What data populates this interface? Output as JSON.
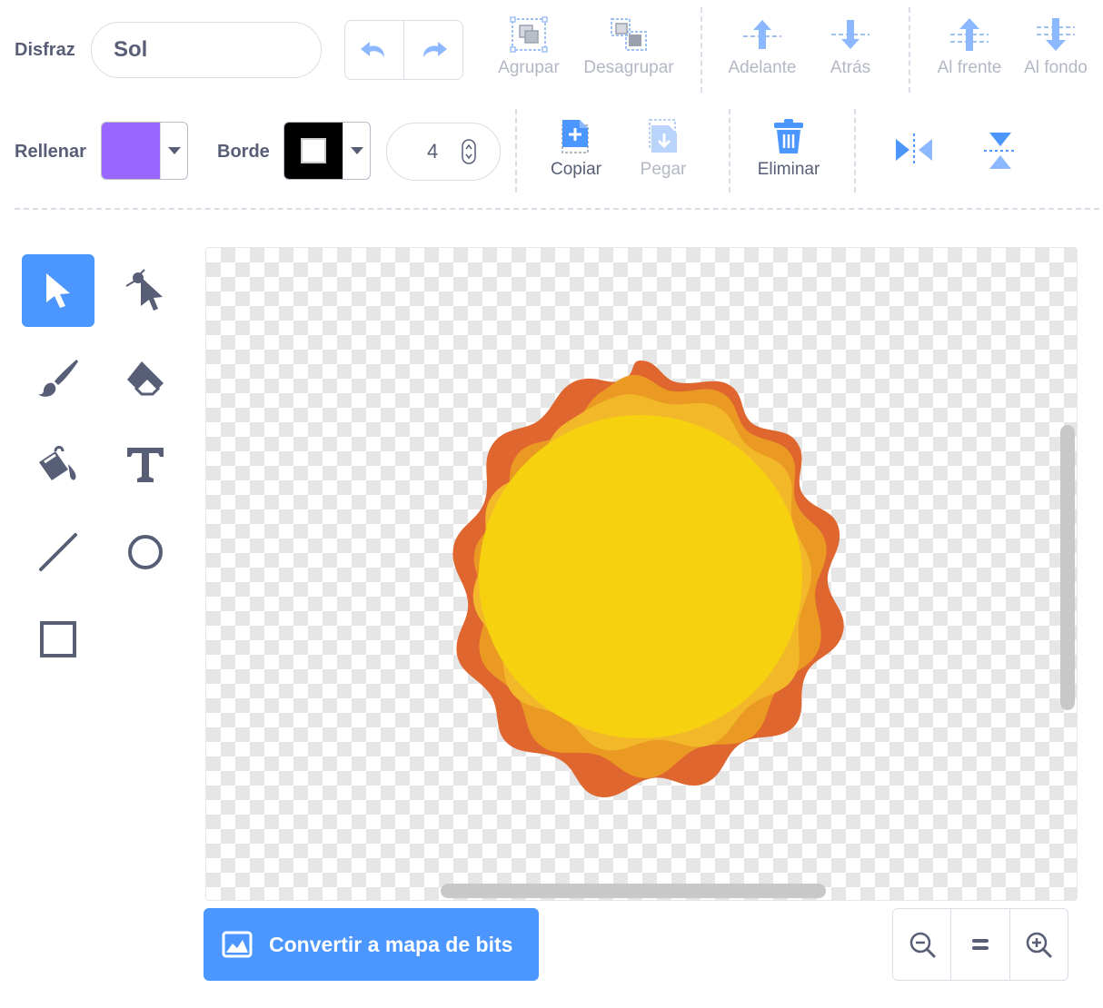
{
  "costume": {
    "label": "Disfraz",
    "name": "Sol"
  },
  "toolbar": {
    "group": "Agrupar",
    "ungroup": "Desagrupar",
    "forward": "Adelante",
    "backward": "Atrás",
    "front": "Al frente",
    "back": "Al fondo",
    "copy": "Copiar",
    "paste": "Pegar",
    "delete": "Eliminar"
  },
  "fill": {
    "label": "Rellenar",
    "color": "#9966ff"
  },
  "outline": {
    "label": "Borde",
    "color": "#000000",
    "width": "4"
  },
  "bitmap_button": "Convertir a mapa de bits",
  "colors": {
    "accent": "#4c97ff",
    "icon": "#575e75",
    "sun_outer": "#e0662f",
    "sun_mid": "#ea9a22",
    "sun_inner": "#f2b82a",
    "sun_core": "#f6d10f"
  },
  "tools": [
    "select-icon",
    "reshape-icon",
    "brush-icon",
    "eraser-icon",
    "fill-icon",
    "text-icon",
    "line-icon",
    "circle-icon",
    "rectangle-icon"
  ]
}
